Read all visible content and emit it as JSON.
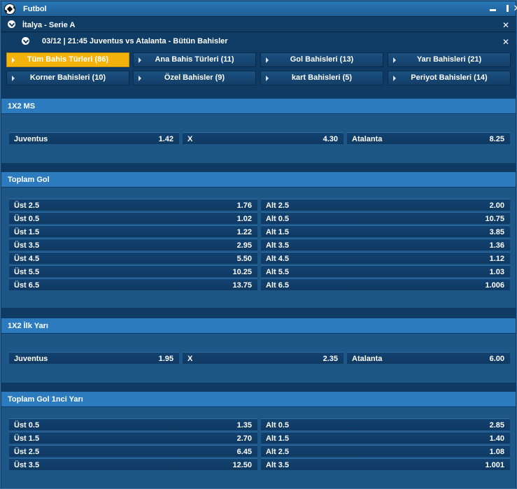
{
  "window": {
    "title": "Futbol",
    "minimize": "",
    "maximize": "",
    "close": "✕"
  },
  "league": {
    "title": "İtalya - Serie A",
    "close": "✕"
  },
  "match": {
    "title": "03/12 | 21:45 Juventus vs Atalanta - Bütün Bahisler",
    "close": "✕"
  },
  "filters": [
    {
      "label": "Tüm Bahis Türleri (86)",
      "active": true
    },
    {
      "label": "Ana Bahis Türleri (11)",
      "active": false
    },
    {
      "label": "Gol Bahisleri (13)",
      "active": false
    },
    {
      "label": "Yarı Bahisleri (21)",
      "active": false
    },
    {
      "label": "Korner Bahisleri (10)",
      "active": false
    },
    {
      "label": "Özel Bahisler (9)",
      "active": false
    },
    {
      "label": "kart Bahisleri (5)",
      "active": false
    },
    {
      "label": "Periyot Bahisleri (14)",
      "active": false
    }
  ],
  "sections": {
    "ms": {
      "title": "1X2 MS",
      "odds": [
        {
          "label": "Juventus",
          "value": "1.42"
        },
        {
          "label": "X",
          "value": "4.30"
        },
        {
          "label": "Atalanta",
          "value": "8.25"
        }
      ]
    },
    "total_goals": {
      "title": "Toplam Gol",
      "rows": [
        {
          "over_label": "Üst 2.5",
          "over_value": "1.76",
          "under_label": "Alt 2.5",
          "under_value": "2.00"
        },
        {
          "over_label": "Üst 0.5",
          "over_value": "1.02",
          "under_label": "Alt 0.5",
          "under_value": "10.75"
        },
        {
          "over_label": "Üst 1.5",
          "over_value": "1.22",
          "under_label": "Alt 1.5",
          "under_value": "3.85"
        },
        {
          "over_label": "Üst 3.5",
          "over_value": "2.95",
          "under_label": "Alt 3.5",
          "under_value": "1.36"
        },
        {
          "over_label": "Üst 4.5",
          "over_value": "5.50",
          "under_label": "Alt 4.5",
          "under_value": "1.12"
        },
        {
          "over_label": "Üst 5.5",
          "over_value": "10.25",
          "under_label": "Alt 5.5",
          "under_value": "1.03"
        },
        {
          "over_label": "Üst 6.5",
          "over_value": "13.75",
          "under_label": "Alt 6.5",
          "under_value": "1.006"
        }
      ]
    },
    "first_half": {
      "title": "1X2 İlk Yarı",
      "odds": [
        {
          "label": "Juventus",
          "value": "1.95"
        },
        {
          "label": "X",
          "value": "2.35"
        },
        {
          "label": "Atalanta",
          "value": "6.00"
        }
      ]
    },
    "first_half_goals": {
      "title": "Toplam Gol 1nci Yarı",
      "rows": [
        {
          "over_label": "Üst 0.5",
          "over_value": "1.35",
          "under_label": "Alt 0.5",
          "under_value": "2.85"
        },
        {
          "over_label": "Üst 1.5",
          "over_value": "2.70",
          "under_label": "Alt 1.5",
          "under_value": "1.40"
        },
        {
          "over_label": "Üst 2.5",
          "over_value": "6.45",
          "under_label": "Alt 2.5",
          "under_value": "1.08"
        },
        {
          "over_label": "Üst 3.5",
          "over_value": "12.50",
          "under_label": "Alt 3.5",
          "under_value": "1.001"
        }
      ]
    }
  }
}
